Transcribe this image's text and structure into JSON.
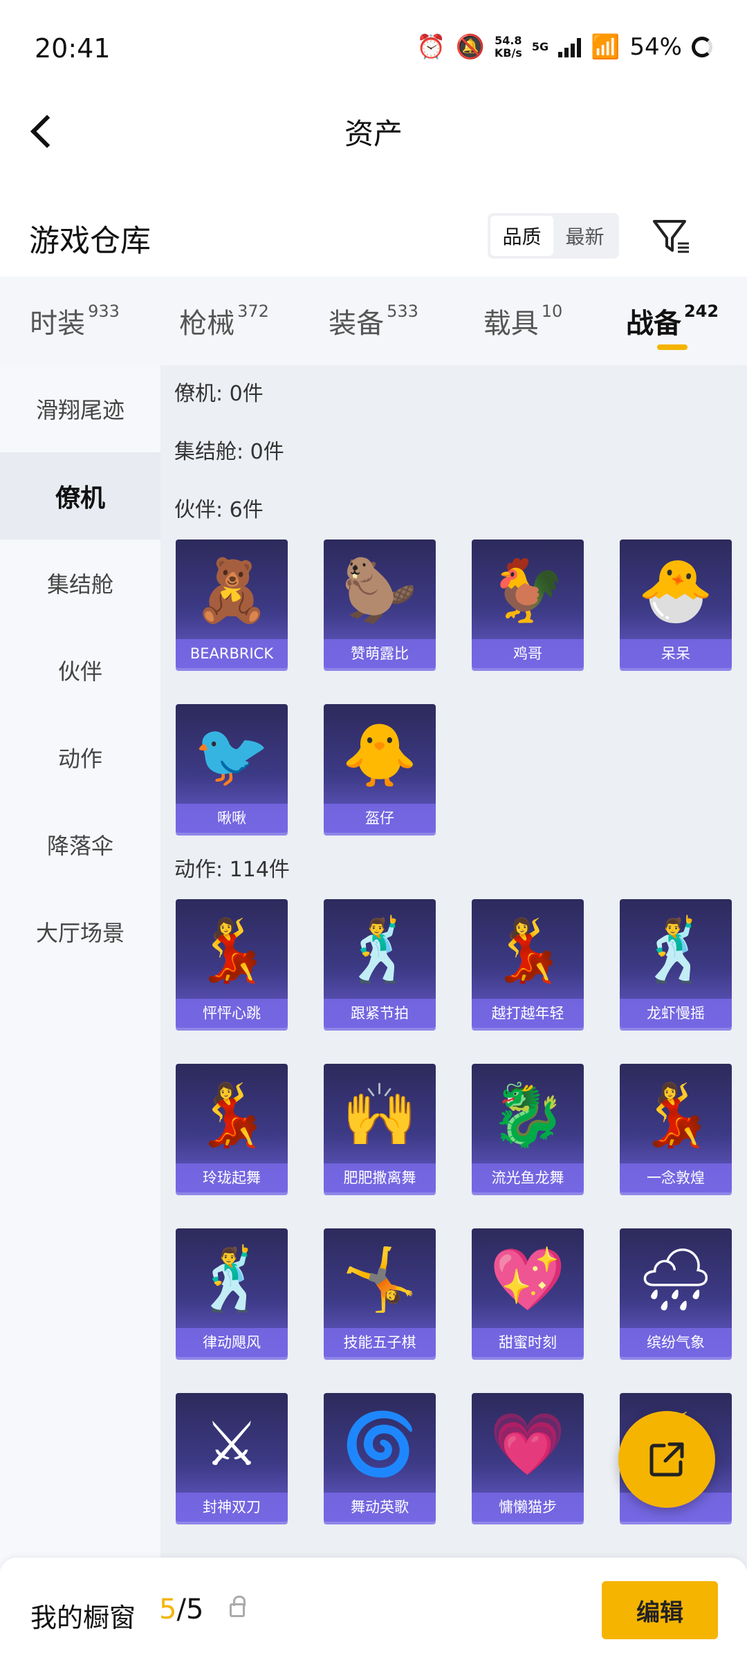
{
  "status_bar": {
    "time": "20:41",
    "net_speed_top": "54.8",
    "net_speed_unit": "KB/s",
    "net_type": "5G",
    "battery": "54%"
  },
  "nav": {
    "title": "资产"
  },
  "warehouse": {
    "title": "游戏仓库",
    "sort_options": [
      "品质",
      "最新"
    ]
  },
  "tabs": [
    {
      "label": "时装",
      "count": "933"
    },
    {
      "label": "枪械",
      "count": "372"
    },
    {
      "label": "装备",
      "count": "533"
    },
    {
      "label": "载具",
      "count": "10"
    },
    {
      "label": "战备",
      "count": "242"
    }
  ],
  "sidebar": [
    "滑翔尾迹",
    "僚机",
    "集结舱",
    "伙伴",
    "动作",
    "降落伞",
    "大厅场景"
  ],
  "sections": {
    "wingman": "僚机: 0件",
    "rally": "集结舱: 0件",
    "partner": "伙伴: 6件",
    "actions": "动作: 114件"
  },
  "partner_items": [
    "BEARBRICK",
    "赞萌露比",
    "鸡哥",
    "呆呆",
    "啾啾",
    "盔仔"
  ],
  "action_items": [
    "怦怦心跳",
    "跟紧节拍",
    "越打越年轻",
    "龙虾慢摇",
    "玲珑起舞",
    "肥肥撒离舞",
    "流光鱼龙舞",
    "一念敦煌",
    "律动飓风",
    "技能五子棋",
    "甜蜜时刻",
    "缤纷气象",
    "封神双刀",
    "舞动英歌",
    "慵懒猫步",
    ""
  ],
  "bottom": {
    "title": "我的橱窗",
    "current": "5",
    "separator": "/",
    "total": "5",
    "edit": "编辑"
  }
}
